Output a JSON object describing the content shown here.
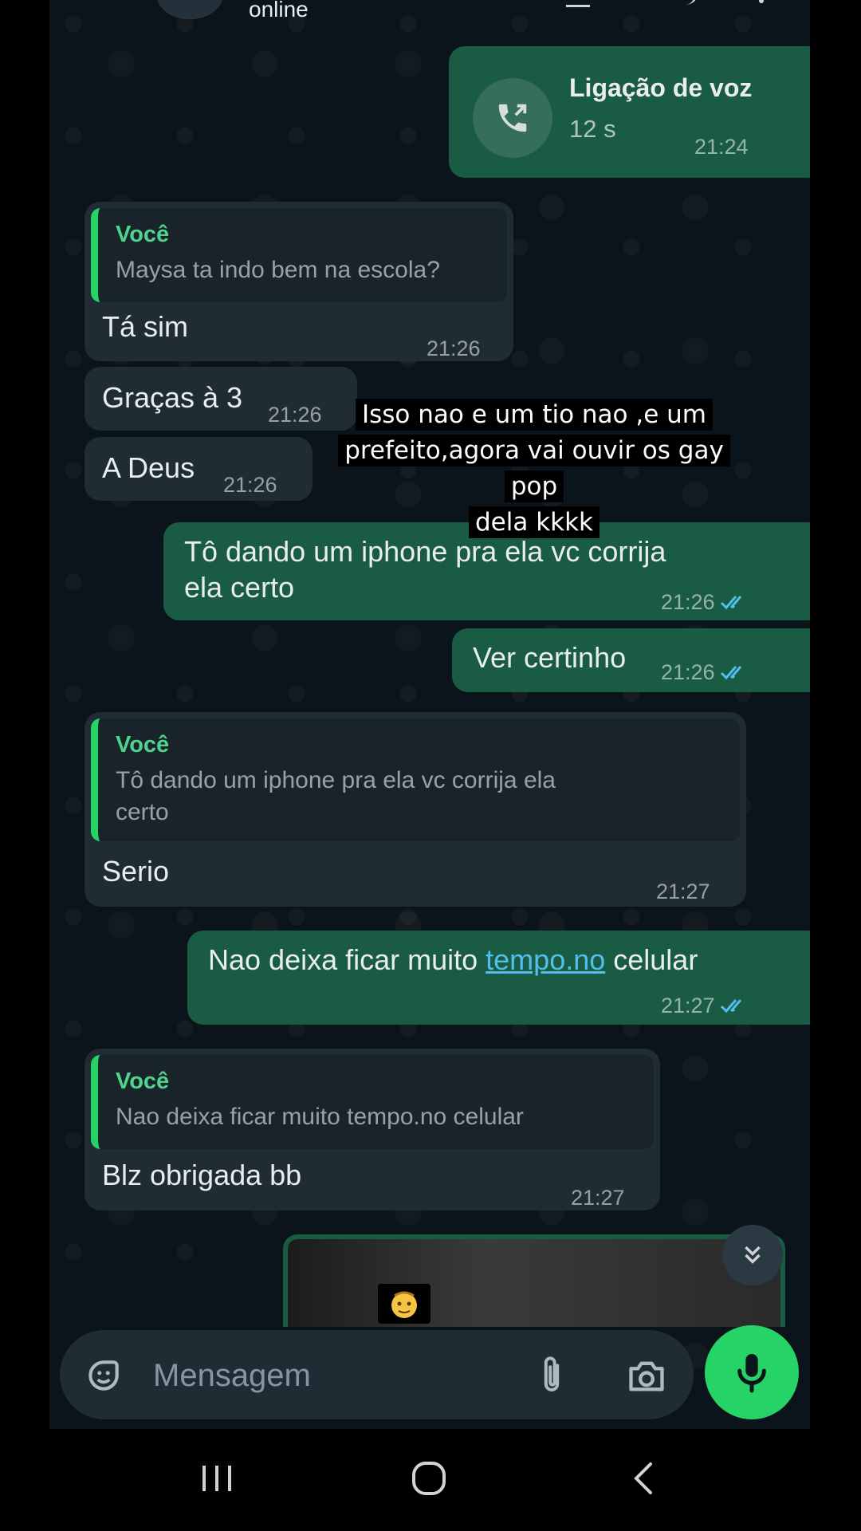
{
  "header": {
    "status": "online"
  },
  "call": {
    "title": "Ligação de voz",
    "duration": "12 s",
    "time": "21:24"
  },
  "messages": [
    {
      "quote_author": "Você",
      "quote_text": "Maysa  ta indo bem na escola?",
      "text": "Tá sim",
      "time": "21:26"
    },
    {
      "text": "Graças à 3",
      "time": "21:26"
    },
    {
      "text": "A Deus",
      "time": "21:26"
    },
    {
      "text_line1": "Tô dando um iphone pra ela vc corrija",
      "text_line2": "ela certo",
      "time": "21:26"
    },
    {
      "text": "Ver certinho",
      "time": "21:26"
    },
    {
      "quote_author": "Você",
      "quote_line1": "Tô dando um iphone pra ela vc corrija ela",
      "quote_line2": "certo",
      "text": "Serio",
      "time": "21:27"
    },
    {
      "text_before": "Nao deixa ficar muito ",
      "link": "tempo.no",
      "text_after": " celular",
      "time": "21:27"
    },
    {
      "quote_author": "Você",
      "quote_text": "Nao deixa ficar muito tempo.no celular",
      "text": "Blz obrigada bb",
      "time": "21:27"
    }
  ],
  "overlay": {
    "line1": "Isso nao e um tio nao ,e um",
    "line2": "prefeito,agora vai ouvir os gay pop",
    "line3": "dela kkkk"
  },
  "composer": {
    "placeholder": "Mensagem"
  },
  "colors": {
    "chat_bg": "#0b141a",
    "incoming": "#1f2c34",
    "outgoing": "#1a5b43",
    "accent": "#25d366",
    "read_ticks": "#53bdeb",
    "link": "#53bdeb"
  },
  "icons": [
    "back-icon",
    "voice-call-icon",
    "sticker-icon",
    "attach-icon",
    "camera-icon",
    "mic-icon",
    "double-chevron-down-icon",
    "recents-icon",
    "home-icon",
    "nav-back-icon"
  ]
}
